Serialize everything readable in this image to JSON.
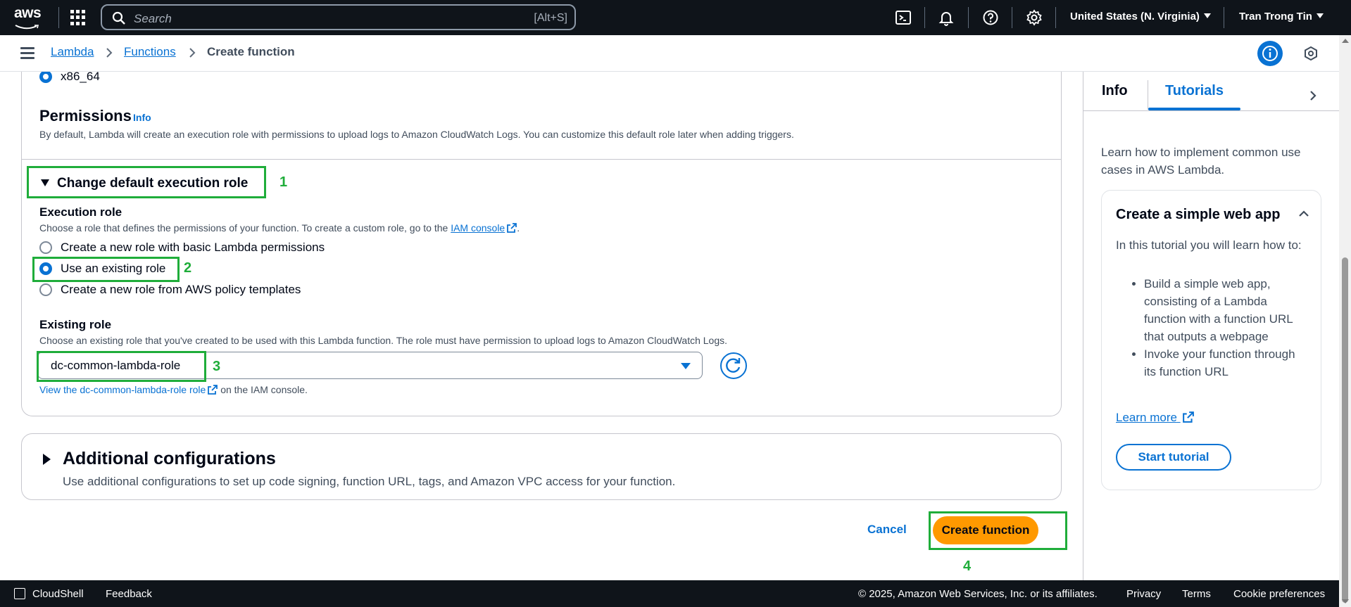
{
  "topbar": {
    "logo_text": "aws",
    "search_placeholder": "Search",
    "search_shortcut": "[Alt+S]",
    "region": "United States (N. Virginia)",
    "user": "Tran Trong Tin"
  },
  "breadcrumb": {
    "items": [
      "Lambda",
      "Functions"
    ],
    "current": "Create function"
  },
  "architecture": {
    "option_label": "x86_64"
  },
  "permissions": {
    "title": "Permissions",
    "info": "Info",
    "description": "By default, Lambda will create an execution role with permissions to upload logs to Amazon CloudWatch Logs. You can customize this default role later when adding triggers.",
    "expander_label": "Change default execution role",
    "execution_role": {
      "label": "Execution role",
      "description_prefix": "Choose a role that defines the permissions of your function. To create a custom role, go to the ",
      "iam_console_link": "IAM console",
      "description_suffix": ".",
      "options": [
        "Create a new role with basic Lambda permissions",
        "Use an existing role",
        "Create a new role from AWS policy templates"
      ],
      "selected_index": 1
    },
    "existing_role": {
      "label": "Existing role",
      "description": "Choose an existing role that you've created to be used with this Lambda function. The role must have permission to upload logs to Amazon CloudWatch Logs.",
      "selected_value": "dc-common-lambda-role",
      "view_link": "View the dc-common-lambda-role role",
      "view_suffix": "on the IAM console."
    }
  },
  "additional": {
    "title": "Additional configurations",
    "description": "Use additional configurations to set up code signing, function URL, tags, and Amazon VPC access for your function."
  },
  "actions": {
    "cancel": "Cancel",
    "create": "Create function"
  },
  "annotations": [
    "1",
    "2",
    "3",
    "4"
  ],
  "side_panel": {
    "tabs": [
      "Info",
      "Tutorials"
    ],
    "active_tab": "Tutorials",
    "intro": "Learn how to implement common use cases in AWS Lambda.",
    "tutorial": {
      "title": "Create a simple web app",
      "paragraph": "In this tutorial you will learn how to:",
      "bullets": [
        "Build a simple web app, consisting of a Lambda function with a function URL that outputs a webpage",
        "Invoke your function through its function URL"
      ],
      "learn_more": "Learn more",
      "start_button": "Start tutorial"
    }
  },
  "footer": {
    "cloudshell": "CloudShell",
    "feedback": "Feedback",
    "copyright": "© 2025, Amazon Web Services, Inc. or its affiliates.",
    "privacy": "Privacy",
    "terms": "Terms",
    "cookies": "Cookie preferences"
  },
  "colors": {
    "accent": "#0972d3",
    "primary_button": "#ff9900",
    "annotation": "#1fad3a",
    "topbar_bg": "#0f141a"
  }
}
